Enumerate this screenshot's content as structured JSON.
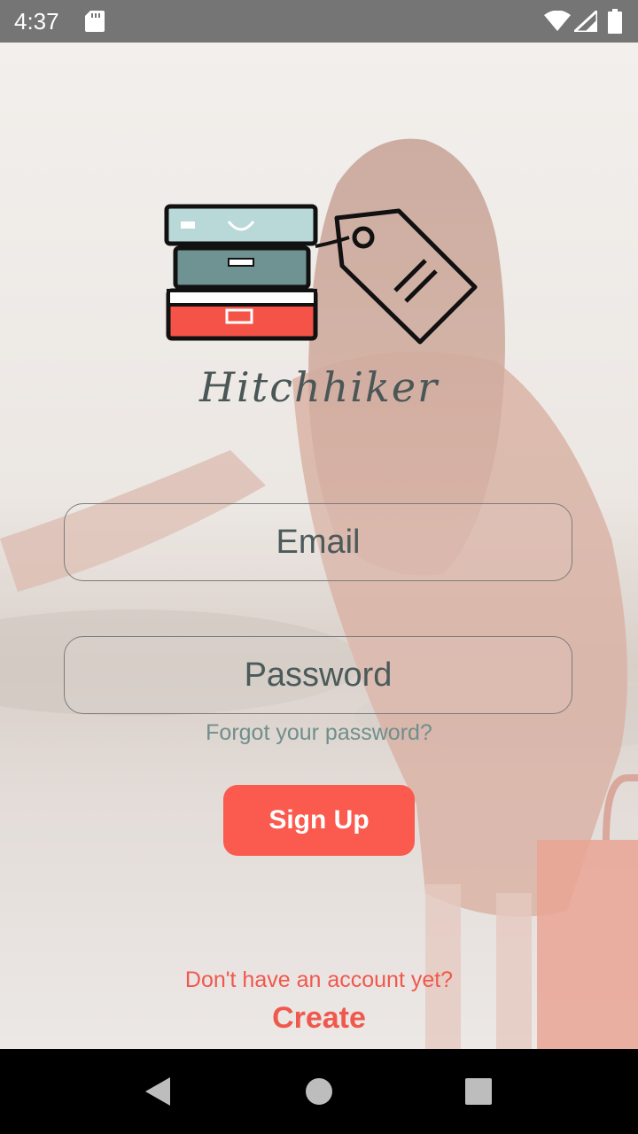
{
  "status_bar": {
    "time": "4:37",
    "icons": [
      "sd-card-icon",
      "wifi-icon",
      "cell-signal-icon",
      "battery-icon"
    ]
  },
  "logo": {
    "wordmark": "Hitchhiker",
    "icon": "suitcases-with-tag-icon"
  },
  "form": {
    "email_placeholder": "Email",
    "password_placeholder": "Password",
    "forgot_password": "Forgot your password?",
    "signup_label": "Sign Up"
  },
  "footer": {
    "prompt": "Don't have an account yet?",
    "create_label": "Create"
  },
  "colors": {
    "accent": "#fb5a4e",
    "link_text": "#f0584d",
    "muted_teal": "#6f8f8c",
    "input_text": "#4b5a5a"
  },
  "nav_bar": {
    "icons": [
      "back-icon",
      "home-icon",
      "recents-icon"
    ]
  }
}
